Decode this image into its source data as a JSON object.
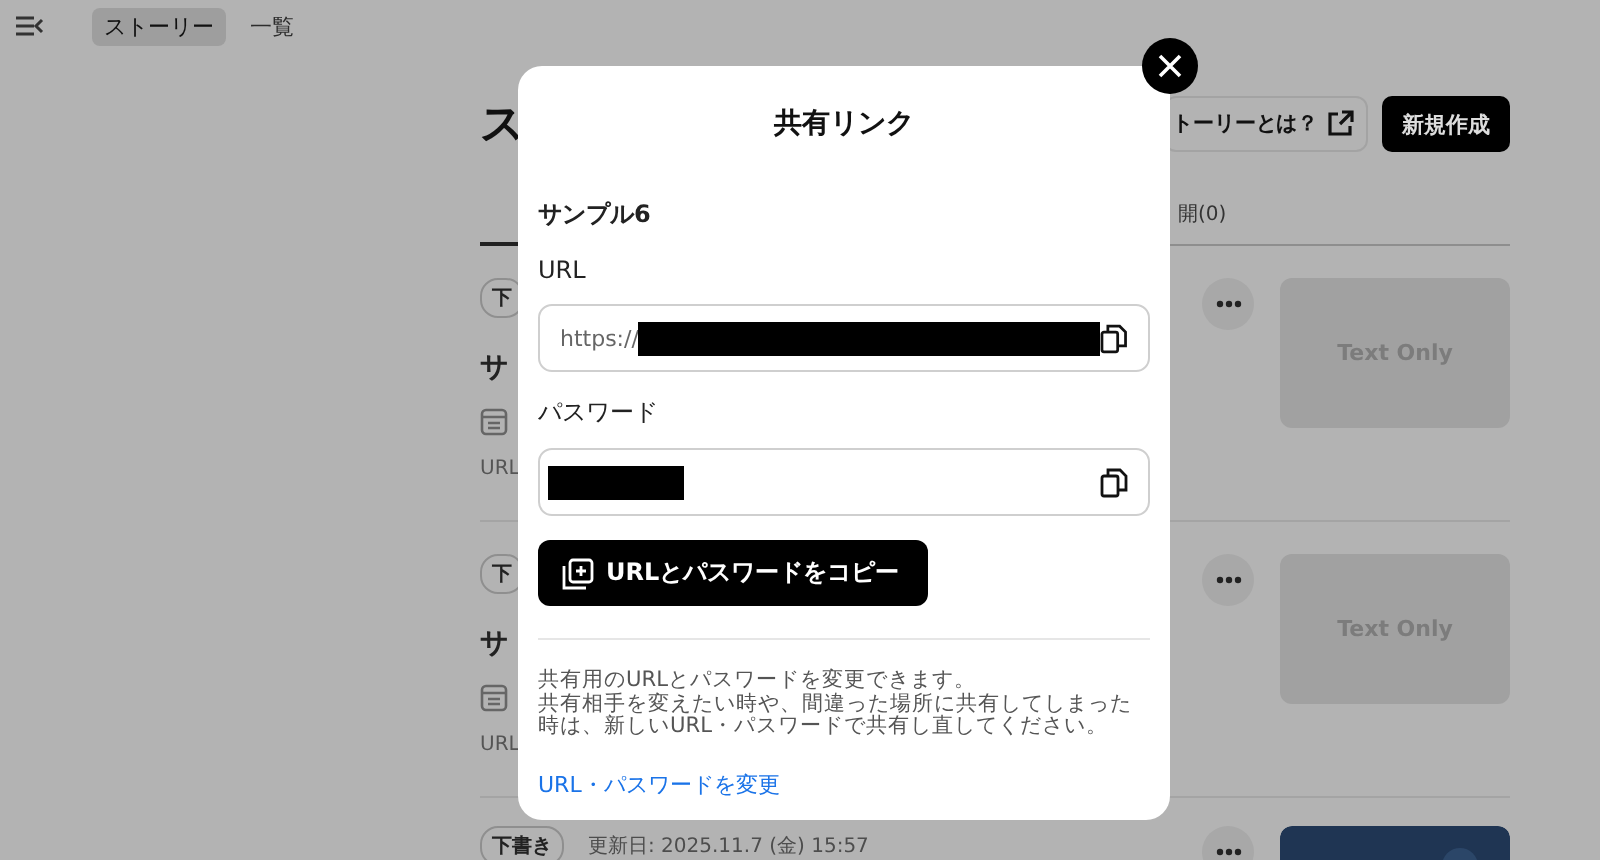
{
  "header": {
    "breadcrumb": [
      {
        "label": "ストーリー",
        "selected": true
      },
      {
        "label": "一覧",
        "selected": false
      }
    ]
  },
  "page": {
    "title": "ス",
    "help_button": "トーリーとは？",
    "new_button": "新規作成",
    "tabs": [
      {
        "label": "開(0)",
        "selected": false
      }
    ]
  },
  "stories": [
    {
      "status": "下",
      "title": "サ",
      "meta": "URL",
      "thumbnail": {
        "kind": "text",
        "label": "Text Only"
      }
    },
    {
      "status": "下",
      "title": "サ",
      "meta": "URL",
      "thumbnail": {
        "kind": "text",
        "label": "Text Only"
      }
    },
    {
      "status": "下書き",
      "updated": "更新日: 2025.11.7 (金) 15:57"
    }
  ],
  "dialog": {
    "title": "共有リンク",
    "story_name": "サンプル6",
    "url_label": "URL",
    "url": {
      "value": "https://",
      "redacted": true
    },
    "password_label": "パスワード",
    "password": {
      "redacted": true
    },
    "copy_button": "URLとパスワードをコピー",
    "description": [
      "共有用のURLとパスワードを変更できます。",
      "共有相手を変えたい時や、間違った場所に共有してしまった時は、新しいURL・パスワードで共有し直してください。"
    ],
    "change_link": "URL・パスワードを変更"
  }
}
